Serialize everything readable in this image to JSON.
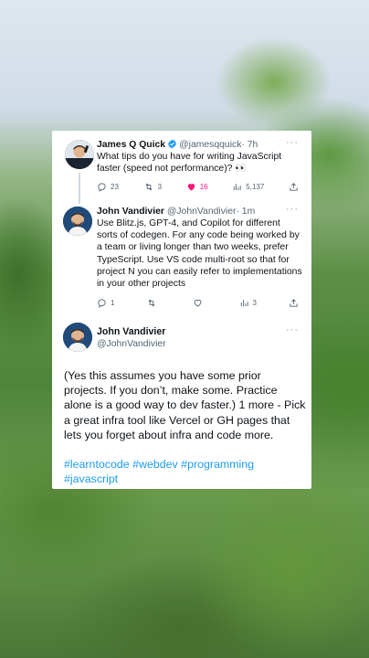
{
  "tweet1": {
    "name": "James Q Quick",
    "handle": "@jamesqquick",
    "time": "· 7h",
    "more": "···",
    "text": "What tips do you have for writing JavaScript faster (speed not performance)? 👀",
    "replies": "23",
    "retweets": "3",
    "likes": "16",
    "views": "5,137",
    "like_color": "#f91880",
    "verified_color": "#1d9bf0"
  },
  "reply1": {
    "name": "John Vandivier",
    "handle": "@JohnVandivier",
    "time": "· 1m",
    "more": "···",
    "text": "Use Blitz.js, GPT-4, and Copilot for different sorts of codegen. For any code being worked by a team or living longer than two weeks, prefer TypeScript. Use VS code multi-root so that for project N you can easily refer to implementations in your other projects",
    "replies": "1",
    "retweets": "",
    "likes": "",
    "views": "3"
  },
  "reply2": {
    "name": "John Vandivier",
    "handle": "@JohnVandivier",
    "more": "···",
    "text": "(Yes this assumes you have some prior projects. If you don’t, make some. Practice alone is a good way to dev faster.) 1 more - Pick a great infra tool like Vercel or GH pages that lets you forget about infra and code more.",
    "hashtags": [
      "#learntocode",
      "#webdev",
      "#programming",
      "#javascript"
    ],
    "hashtag_color": "#1d9bf0"
  },
  "icons": [
    "reply-icon",
    "retweet-icon",
    "heart-icon",
    "views-icon",
    "share-icon",
    "verified-icon",
    "more-icon"
  ]
}
